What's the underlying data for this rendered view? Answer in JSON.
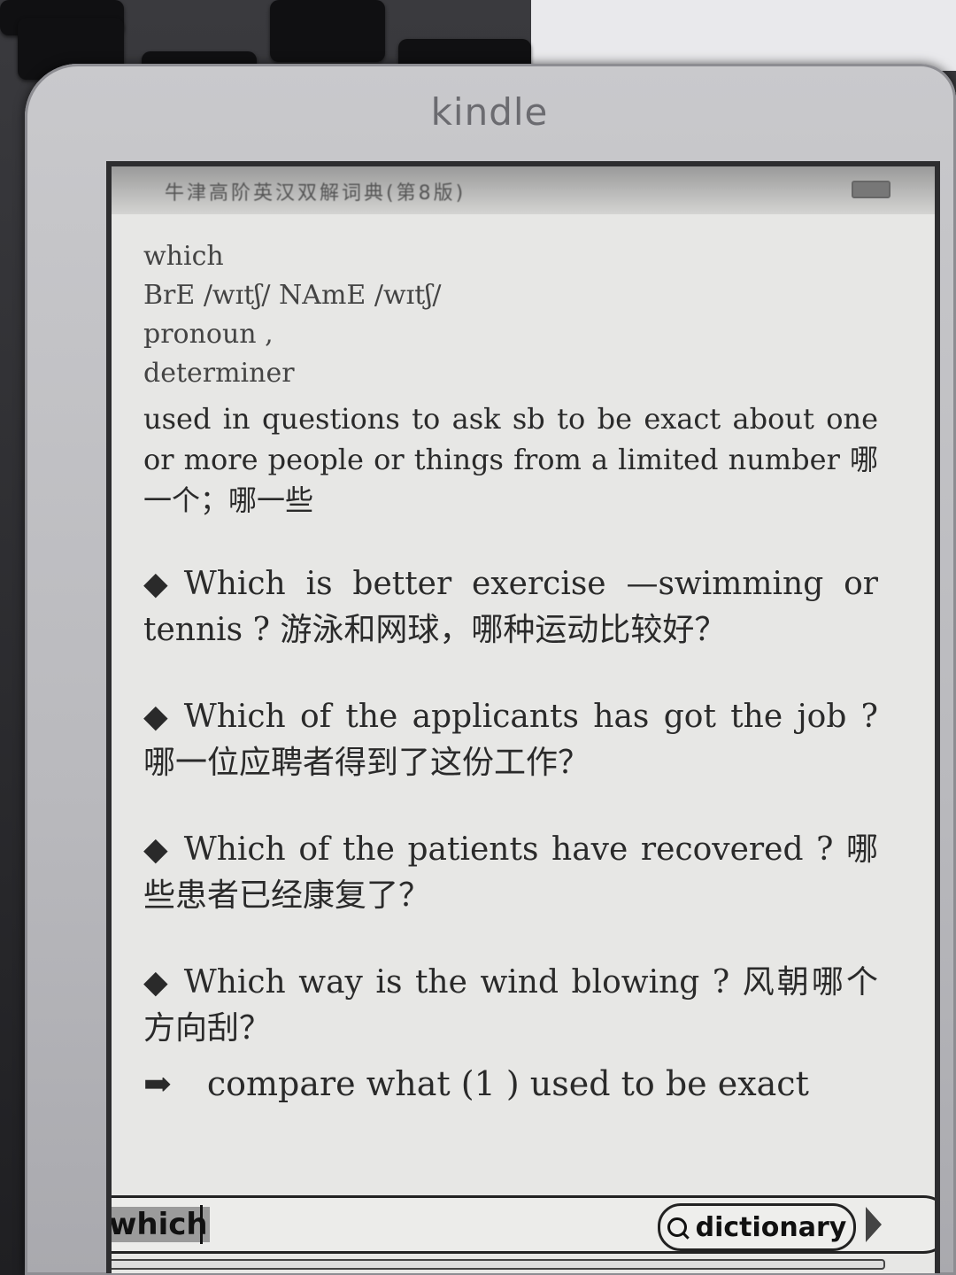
{
  "device": {
    "brand": "kindle"
  },
  "status": {
    "title": "牛津高阶英汉双解词典(第8版)"
  },
  "entry": {
    "headword": "which",
    "pronunciation": "BrE /wɪtʃ/ NAmE /wɪtʃ/",
    "pos_1": "pronoun ,",
    "pos_2": "determiner",
    "definition": "used in questions to ask sb to be exact about one or more people or things from a limited number 哪一个；哪一些"
  },
  "examples": [
    {
      "bullet": "◆",
      "text": "Which is better exercise —swimming or tennis ? 游泳和网球，哪种运动比较好？"
    },
    {
      "bullet": "◆",
      "text": "Which of the applicants has got the job ? 哪一位应聘者得到了这份工作？"
    },
    {
      "bullet": "◆",
      "text": "Which of the patients have recovered ? 哪些患者已经康复了？"
    },
    {
      "bullet": "◆",
      "text": "Which way is the wind blowing ? 风朝哪个方向刮？"
    }
  ],
  "compare": {
    "arrow": "➡",
    "text": "compare what (1 ) used to be exact"
  },
  "search": {
    "value": "which",
    "button_label": "dictionary"
  }
}
